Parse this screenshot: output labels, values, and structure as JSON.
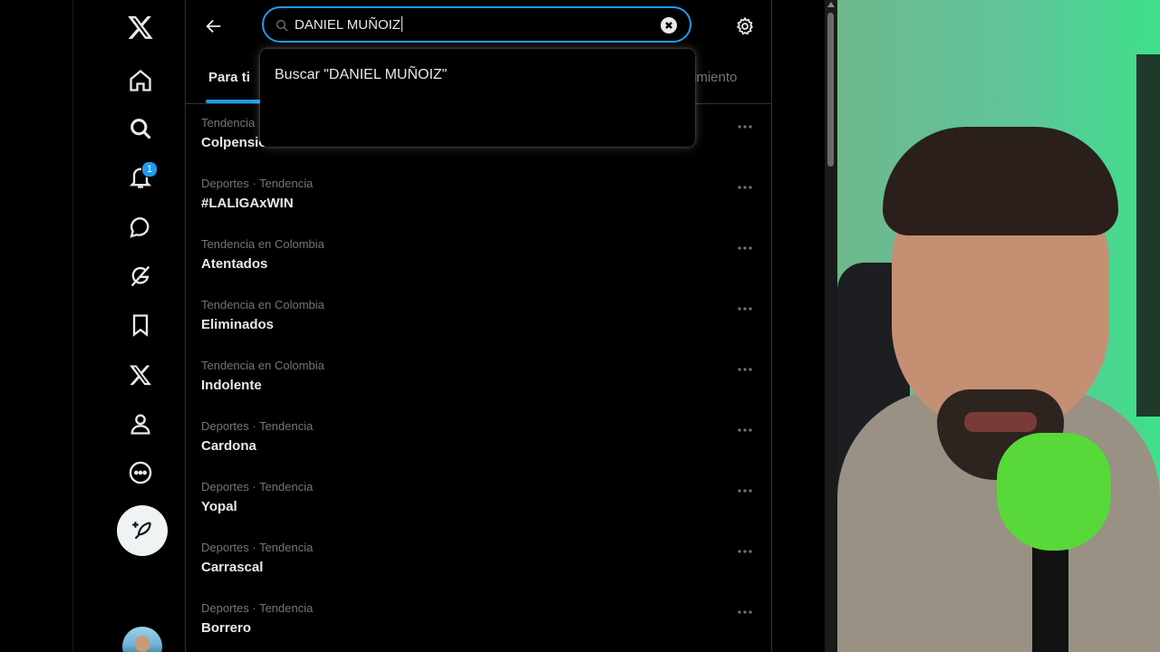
{
  "search": {
    "value": "DANIEL MUÑOIZ",
    "suggestion": "Buscar \"DANIEL MUÑOIZ\""
  },
  "nav": {
    "notifications_badge": "1"
  },
  "tabs": [
    {
      "label": "Para ti"
    },
    {
      "label": "imiento"
    }
  ],
  "trends": [
    {
      "meta": "Tendencia",
      "name": "Colpensiones"
    },
    {
      "meta": "Deportes · Tendencia",
      "name": "#LALIGAxWIN"
    },
    {
      "meta": "Tendencia en Colombia",
      "name": "Atentados"
    },
    {
      "meta": "Tendencia en Colombia",
      "name": "Eliminados"
    },
    {
      "meta": "Tendencia en Colombia",
      "name": "Indolente"
    },
    {
      "meta": "Deportes · Tendencia",
      "name": "Cardona"
    },
    {
      "meta": "Deportes · Tendencia",
      "name": "Yopal"
    },
    {
      "meta": "Deportes · Tendencia",
      "name": "Carrascal"
    },
    {
      "meta": "Deportes · Tendencia",
      "name": "Borrero"
    }
  ],
  "icons": {
    "logo": "x-logo-icon",
    "home": "home-icon",
    "explore": "search-icon",
    "notifications": "bell-icon",
    "messages": "chat-bubble-icon",
    "grok": "grok-icon",
    "bookmarks": "bookmark-icon",
    "premium": "x-premium-icon",
    "profile": "person-icon",
    "more": "more-circle-icon",
    "post": "feather-plus-icon",
    "settings": "gear-icon",
    "back": "arrow-left-icon",
    "clear": "close-circle-icon"
  },
  "colors": {
    "accent": "#1d9bf0",
    "background": "#000000",
    "text": "#e7e9ea",
    "muted": "#71767b"
  }
}
